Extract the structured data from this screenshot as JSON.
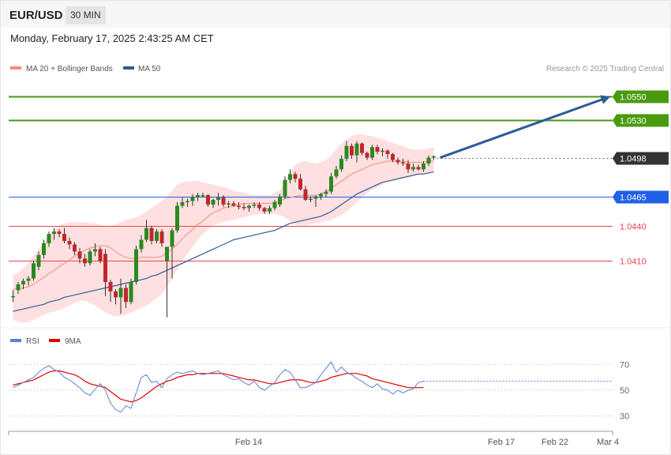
{
  "header": {
    "symbol": "EUR/USD",
    "interval": "30 MIN",
    "datetime": "Monday, February 17, 2025 2:43:25 AM CET"
  },
  "legend": {
    "main": [
      {
        "name": "MA 20 + Bollinger Bands",
        "color": "#f28b82"
      },
      {
        "name": "MA 50",
        "color": "#2d5b9a"
      }
    ],
    "rsi": [
      {
        "name": "RSI",
        "color": "#5b7fd6"
      },
      {
        "name": "9MA",
        "color": "#e00000"
      }
    ]
  },
  "credit": "Research © 2025 Trading Central",
  "colors": {
    "up": "#2a8a1f",
    "down": "#c0272d",
    "resistance": "#4a9a10",
    "support": "#e0484d",
    "pivot": "#2060e8",
    "current": "#333333",
    "bands": "#ffe0e0",
    "ma20": "#f28b82",
    "ma50": "#2d5b9a",
    "arrow": "#2d5b9a"
  },
  "chart_data": [
    {
      "type": "candlestick",
      "title": "EUR/USD 30 MIN",
      "ylim": [
        1.0355,
        1.0565
      ],
      "x_ticks": [
        "Feb 14",
        "Feb 17",
        "Feb 22",
        "Mar 4"
      ],
      "current_price": 1.0498,
      "levels": [
        {
          "label": "1.0550",
          "value": 1.055,
          "kind": "resistance"
        },
        {
          "label": "1.0530",
          "value": 1.053,
          "kind": "resistance"
        },
        {
          "label": "1.0498",
          "value": 1.0498,
          "kind": "current"
        },
        {
          "label": "1.0465",
          "value": 1.0465,
          "kind": "pivot"
        },
        {
          "label": "1.0440",
          "value": 1.044,
          "kind": "support"
        },
        {
          "label": "1.0410",
          "value": 1.041,
          "kind": "support"
        }
      ],
      "forecast_arrow": {
        "from": 1.0498,
        "to": 1.055
      },
      "candles": [
        [
          1.038,
          1.0385,
          1.0375,
          1.038
        ],
        [
          1.0385,
          1.0392,
          1.0382,
          1.039
        ],
        [
          1.039,
          1.0395,
          1.0386,
          1.0393
        ],
        [
          1.0393,
          1.0397,
          1.0389,
          1.0395
        ],
        [
          1.0395,
          1.041,
          1.0393,
          1.0408
        ],
        [
          1.0405,
          1.0418,
          1.0402,
          1.0415
        ],
        [
          1.0415,
          1.0428,
          1.0412,
          1.0425
        ],
        [
          1.0425,
          1.0435,
          1.0422,
          1.0433
        ],
        [
          1.0433,
          1.0438,
          1.0428,
          1.0435
        ],
        [
          1.0435,
          1.0437,
          1.043,
          1.0433
        ],
        [
          1.0433,
          1.0438,
          1.0425,
          1.0427
        ],
        [
          1.0427,
          1.043,
          1.042,
          1.0424
        ],
        [
          1.0424,
          1.0426,
          1.0415,
          1.0418
        ],
        [
          1.0418,
          1.0421,
          1.0408,
          1.0412
        ],
        [
          1.0412,
          1.0416,
          1.0405,
          1.0408
        ],
        [
          1.0408,
          1.042,
          1.0406,
          1.0418
        ],
        [
          1.0418,
          1.0425,
          1.0414,
          1.042
        ],
        [
          1.042,
          1.0422,
          1.0408,
          1.041
        ],
        [
          1.0416,
          1.042,
          1.038,
          1.0392
        ],
        [
          1.0392,
          1.0394,
          1.0375,
          1.0384
        ],
        [
          1.0384,
          1.0386,
          1.0373,
          1.0379
        ],
        [
          1.0379,
          1.0395,
          1.0365,
          1.0387
        ],
        [
          1.0387,
          1.039,
          1.037,
          1.0375
        ],
        [
          1.0375,
          1.0395,
          1.0373,
          1.0392
        ],
        [
          1.0392,
          1.0423,
          1.039,
          1.042
        ],
        [
          1.042,
          1.0432,
          1.0417,
          1.0428
        ],
        [
          1.0428,
          1.0445,
          1.0426,
          1.0438
        ],
        [
          1.0438,
          1.044,
          1.0424,
          1.0427
        ],
        [
          1.0427,
          1.0437,
          1.0425,
          1.0435
        ],
        [
          1.0435,
          1.0437,
          1.0422,
          1.0425
        ],
        [
          1.041,
          1.0422,
          1.0362,
          1.0422
        ],
        [
          1.0422,
          1.0438,
          1.0395,
          1.0436
        ],
        [
          1.0436,
          1.046,
          1.0434,
          1.0457
        ],
        [
          1.0457,
          1.0464,
          1.0455,
          1.046
        ],
        [
          1.046,
          1.0463,
          1.0456,
          1.0461
        ],
        [
          1.0461,
          1.0467,
          1.0457,
          1.0464
        ],
        [
          1.0464,
          1.0468,
          1.0461,
          1.0466
        ],
        [
          1.0466,
          1.0468,
          1.0464,
          1.0466
        ],
        [
          1.0466,
          1.0467,
          1.0456,
          1.0458
        ],
        [
          1.0458,
          1.0463,
          1.0455,
          1.0462
        ],
        [
          1.0462,
          1.0468,
          1.0457,
          1.0464
        ],
        [
          1.0464,
          1.0466,
          1.0456,
          1.0458
        ],
        [
          1.0458,
          1.0461,
          1.0455,
          1.0459
        ],
        [
          1.0459,
          1.0461,
          1.0456,
          1.0457
        ],
        [
          1.0457,
          1.046,
          1.0454,
          1.0456
        ],
        [
          1.0456,
          1.0459,
          1.0453,
          1.0455
        ],
        [
          1.0455,
          1.0458,
          1.0452,
          1.0457
        ],
        [
          1.0457,
          1.046,
          1.0455,
          1.0458
        ],
        [
          1.0458,
          1.046,
          1.0453,
          1.0455
        ],
        [
          1.0455,
          1.0456,
          1.045,
          1.0452
        ],
        [
          1.0452,
          1.0457,
          1.045,
          1.0455
        ],
        [
          1.0455,
          1.0462,
          1.0453,
          1.046
        ],
        [
          1.0458,
          1.0467,
          1.0456,
          1.0465
        ],
        [
          1.0465,
          1.0482,
          1.0463,
          1.0479
        ],
        [
          1.0479,
          1.0488,
          1.0476,
          1.0484
        ],
        [
          1.0484,
          1.0486,
          1.0477,
          1.048
        ],
        [
          1.048,
          1.0484,
          1.047,
          1.0471
        ],
        [
          1.0471,
          1.0474,
          1.0461,
          1.0462
        ],
        [
          1.0462,
          1.0465,
          1.046,
          1.0463
        ],
        [
          1.0463,
          1.0466,
          1.0456,
          1.0465
        ],
        [
          1.0465,
          1.0468,
          1.0462,
          1.0467
        ],
        [
          1.0467,
          1.0471,
          1.0464,
          1.0469
        ],
        [
          1.0469,
          1.0485,
          1.0467,
          1.0482
        ],
        [
          1.0482,
          1.0491,
          1.048,
          1.0488
        ],
        [
          1.0488,
          1.05,
          1.0486,
          1.0497
        ],
        [
          1.0497,
          1.0512,
          1.0495,
          1.0508
        ],
        [
          1.0508,
          1.051,
          1.0497,
          1.05
        ],
        [
          1.05,
          1.0512,
          1.0494,
          1.051
        ],
        [
          1.051,
          1.0511,
          1.05,
          1.0502
        ],
        [
          1.0502,
          1.0503,
          1.0496,
          1.0498
        ],
        [
          1.0498,
          1.0509,
          1.0496,
          1.0507
        ],
        [
          1.0507,
          1.0509,
          1.0501,
          1.0503
        ],
        [
          1.0503,
          1.0506,
          1.0499,
          1.0504
        ],
        [
          1.0504,
          1.0505,
          1.0497,
          1.0501
        ],
        [
          1.0501,
          1.0502,
          1.0494,
          1.0496
        ],
        [
          1.0496,
          1.0498,
          1.0492,
          1.0494
        ],
        [
          1.0494,
          1.0497,
          1.0491,
          1.0493
        ],
        [
          1.0493,
          1.0496,
          1.0485,
          1.0488
        ],
        [
          1.0488,
          1.0493,
          1.0486,
          1.049
        ],
        [
          1.049,
          1.0492,
          1.0487,
          1.0488
        ],
        [
          1.0488,
          1.0495,
          1.0486,
          1.0493
        ],
        [
          1.0493,
          1.05,
          1.0491,
          1.0498
        ],
        [
          1.0498,
          1.05,
          1.0496,
          1.0499
        ]
      ],
      "series": [
        {
          "name": "MA 20",
          "values": [
            1.0386,
            1.0386,
            1.0387,
            1.0388,
            1.039,
            1.0393,
            1.0396,
            1.0399,
            1.0402,
            1.0405,
            1.0408,
            1.0411,
            1.0414,
            1.0417,
            1.0419,
            1.0421,
            1.0422,
            1.0423,
            1.0423,
            1.0421,
            1.0418,
            1.0415,
            1.0413,
            1.0412,
            1.0412,
            1.0413,
            1.0413,
            1.0413,
            1.0413,
            1.0414,
            1.0417,
            1.042,
            1.0424,
            1.0429,
            1.0433,
            1.0437,
            1.0441,
            1.0444,
            1.0448,
            1.0451,
            1.0453,
            1.0455,
            1.0456,
            1.0457,
            1.0458,
            1.0459,
            1.0459,
            1.0459,
            1.0459,
            1.0459,
            1.0459,
            1.046,
            1.0461,
            1.0463,
            1.0464,
            1.0465,
            1.0466,
            1.0466,
            1.0466,
            1.0466,
            1.0467,
            1.0469,
            1.0472,
            1.0475,
            1.0478,
            1.0481,
            1.0484,
            1.0486,
            1.0488,
            1.049,
            1.0492,
            1.0493,
            1.0494,
            1.0495,
            1.0495,
            1.0495,
            1.0495,
            1.0494,
            1.0494,
            1.0494,
            1.0494,
            1.0495,
            1.0495
          ]
        },
        {
          "name": "MA 50",
          "values": [
            1.0367,
            1.0368,
            1.0369,
            1.037,
            1.0371,
            1.0372,
            1.0373,
            1.0375,
            1.0376,
            1.0377,
            1.0379,
            1.038,
            1.0381,
            1.0382,
            1.0383,
            1.0384,
            1.0385,
            1.0386,
            1.0387,
            1.0388,
            1.0389,
            1.039,
            1.0391,
            1.0392,
            1.0393,
            1.0394,
            1.0395,
            1.0397,
            1.0398,
            1.04,
            1.0402,
            1.0404,
            1.0406,
            1.0408,
            1.041,
            1.0412,
            1.0414,
            1.0416,
            1.0418,
            1.042,
            1.0422,
            1.0424,
            1.0426,
            1.0428,
            1.0429,
            1.043,
            1.0431,
            1.0432,
            1.0433,
            1.0434,
            1.0435,
            1.0436,
            1.0438,
            1.044,
            1.0442,
            1.0443,
            1.0444,
            1.0445,
            1.0446,
            1.0447,
            1.0448,
            1.045,
            1.0452,
            1.0455,
            1.0458,
            1.0461,
            1.0464,
            1.0467,
            1.0469,
            1.0471,
            1.0473,
            1.0475,
            1.0477,
            1.0478,
            1.0479,
            1.048,
            1.0481,
            1.0482,
            1.0483,
            1.0484,
            1.0484,
            1.0485,
            1.0486
          ]
        },
        {
          "name": "Bollinger Upper",
          "values": [
            1.0398,
            1.04,
            1.0404,
            1.0408,
            1.0414,
            1.042,
            1.0426,
            1.0432,
            1.0437,
            1.044,
            1.0442,
            1.0443,
            1.0443,
            1.0443,
            1.0443,
            1.0442,
            1.0442,
            1.0441,
            1.044,
            1.044,
            1.0441,
            1.0443,
            1.0445,
            1.0446,
            1.0447,
            1.0449,
            1.0452,
            1.0455,
            1.0458,
            1.0461,
            1.0465,
            1.047,
            1.0475,
            1.0477,
            1.0478,
            1.0478,
            1.0478,
            1.0477,
            1.0476,
            1.0475,
            1.0474,
            1.0473,
            1.0472,
            1.047,
            1.0469,
            1.0468,
            1.0467,
            1.0466,
            1.0466,
            1.0466,
            1.0466,
            1.0468,
            1.047,
            1.0478,
            1.0486,
            1.0492,
            1.0494,
            1.0495,
            1.0494,
            1.0493,
            1.0494,
            1.0496,
            1.05,
            1.0505,
            1.051,
            1.0514,
            1.0516,
            1.0518,
            1.0518,
            1.0517,
            1.0516,
            1.0515,
            1.0514,
            1.0512,
            1.0511,
            1.0509,
            1.0508,
            1.0506,
            1.0505,
            1.0505,
            1.0505,
            1.0506,
            1.0507
          ]
        },
        {
          "name": "Bollinger Lower",
          "values": [
            1.036,
            1.0358,
            1.0357,
            1.0358,
            1.036,
            1.0362,
            1.0364,
            1.0366,
            1.0367,
            1.0368,
            1.037,
            1.0372,
            1.0374,
            1.0376,
            1.0376,
            1.0374,
            1.0372,
            1.0369,
            1.0366,
            1.0364,
            1.0363,
            1.0363,
            1.0364,
            1.0366,
            1.0368,
            1.037,
            1.0372,
            1.0375,
            1.0378,
            1.0382,
            1.0388,
            1.0395,
            1.0403,
            1.041,
            1.0416,
            1.0422,
            1.0428,
            1.0433,
            1.0437,
            1.044,
            1.0442,
            1.0443,
            1.0444,
            1.0445,
            1.0446,
            1.0447,
            1.0448,
            1.0449,
            1.045,
            1.045,
            1.045,
            1.045,
            1.0449,
            1.0447,
            1.0444,
            1.0441,
            1.044,
            1.044,
            1.0441,
            1.0442,
            1.0443,
            1.0444,
            1.0445,
            1.0447,
            1.0449,
            1.0452,
            1.0456,
            1.046,
            1.0464,
            1.0468,
            1.0471,
            1.0473,
            1.0475,
            1.0477,
            1.0478,
            1.0479,
            1.048,
            1.0481,
            1.0482,
            1.0483,
            1.0484,
            1.0485,
            1.0486
          ]
        }
      ]
    },
    {
      "type": "line",
      "title": "RSI",
      "ylim": [
        20,
        80
      ],
      "y_ticks": [
        70,
        50,
        30
      ],
      "series": [
        {
          "name": "RSI",
          "values": [
            52,
            54,
            56,
            58,
            60,
            64,
            67,
            69,
            66,
            64,
            60,
            58,
            55,
            52,
            48,
            46,
            51,
            55,
            50,
            40,
            35,
            33,
            38,
            36,
            48,
            60,
            62,
            56,
            57,
            52,
            59,
            62,
            64,
            63,
            64,
            65,
            63,
            62,
            63,
            64,
            65,
            62,
            60,
            58,
            59,
            56,
            54,
            57,
            52,
            50,
            53,
            56,
            62,
            66,
            64,
            58,
            52,
            52,
            54,
            56,
            62,
            67,
            72,
            64,
            68,
            64,
            62,
            59,
            57,
            54,
            52,
            55,
            51,
            50,
            47,
            50,
            48,
            50,
            51,
            56,
            57
          ]
        },
        {
          "name": "9MA",
          "values": [
            54,
            55,
            56,
            57,
            58,
            60,
            62,
            64,
            65,
            65,
            64,
            63,
            62,
            60,
            57,
            55,
            54,
            53,
            52,
            49,
            46,
            43,
            42,
            41,
            42,
            44,
            47,
            50,
            53,
            55,
            57,
            58,
            60,
            61,
            62,
            62,
            63,
            63,
            63,
            63,
            63,
            63,
            62,
            61,
            60,
            59,
            58,
            58,
            57,
            56,
            55,
            55,
            56,
            57,
            58,
            58,
            58,
            57,
            56,
            56,
            57,
            58,
            60,
            61,
            62,
            63,
            63,
            63,
            62,
            61,
            59,
            58,
            57,
            56,
            55,
            54,
            53,
            52,
            52,
            52,
            52
          ]
        }
      ]
    }
  ]
}
